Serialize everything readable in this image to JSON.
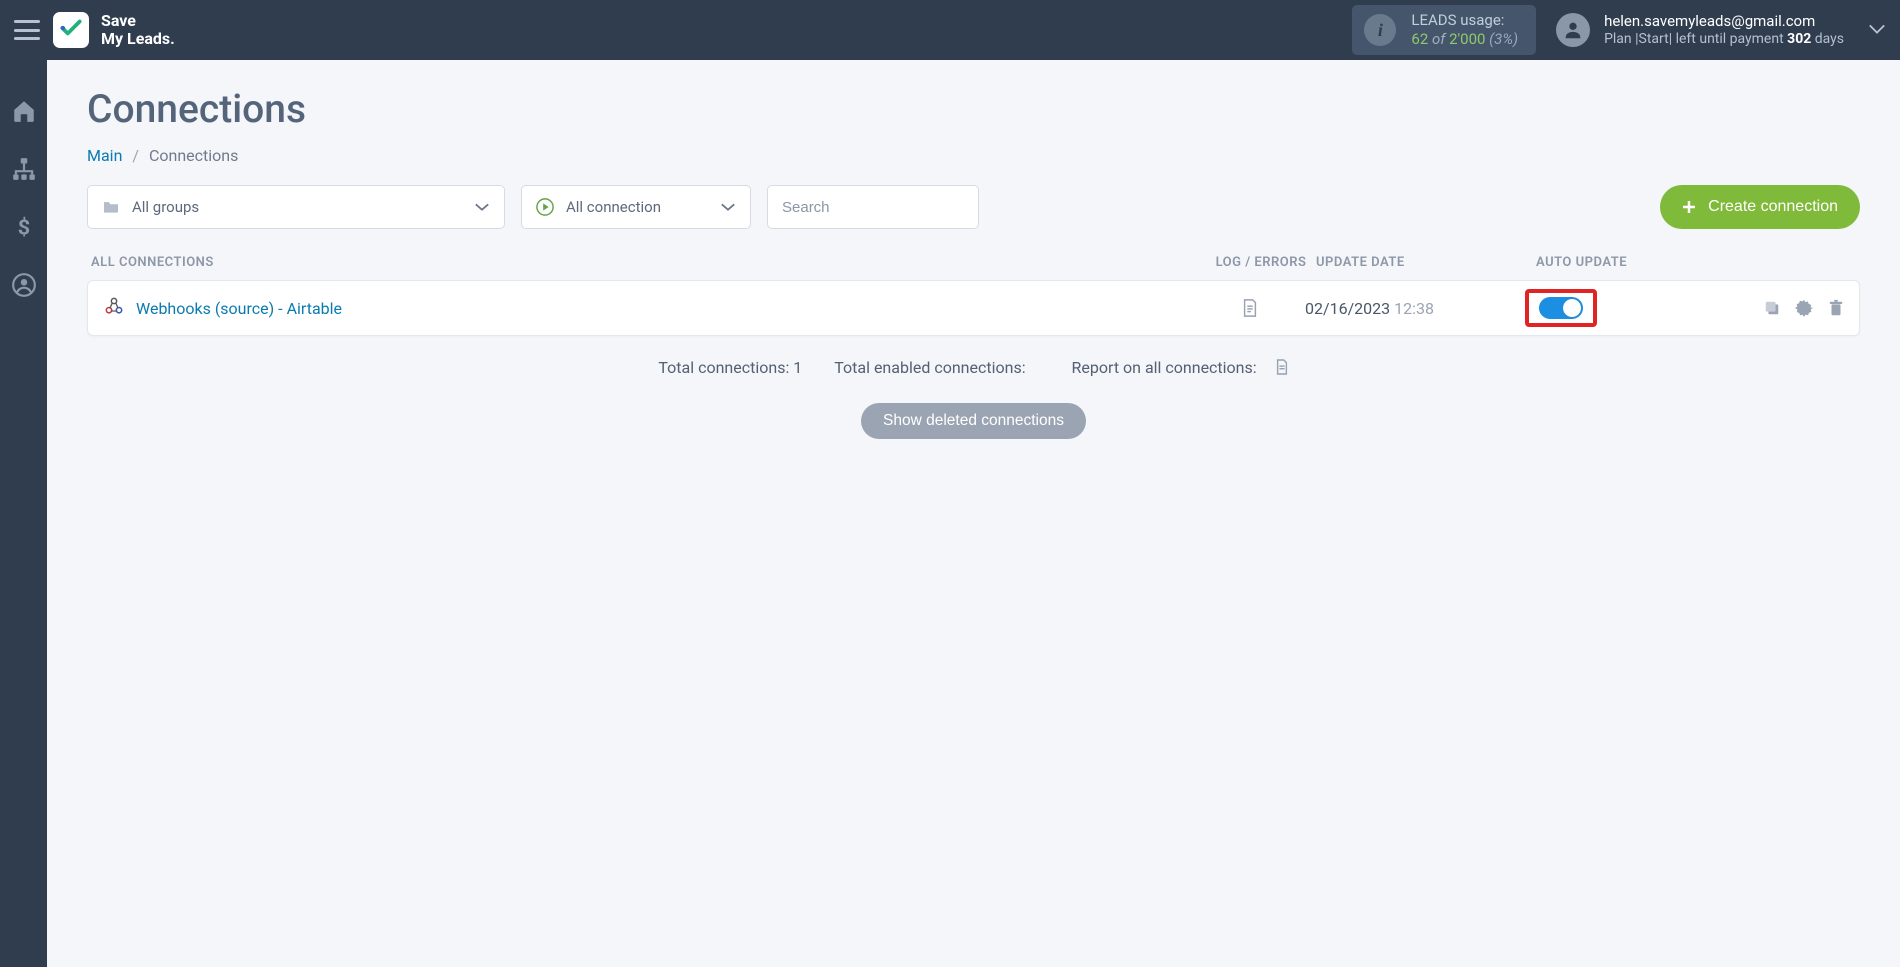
{
  "brand": {
    "line1": "Save",
    "line2": "My Leads."
  },
  "usage": {
    "label": "LEADS usage:",
    "used": "62",
    "of_word": "of",
    "limit": "2'000",
    "pct": "(3%)"
  },
  "account": {
    "email": "helen.savemyleads@gmail.com",
    "plan_prefix": "Plan |Start|  left until payment ",
    "plan_days": "302",
    "plan_suffix": " days"
  },
  "page": {
    "title": "Connections",
    "crumb_main": "Main",
    "crumb_current": "Connections"
  },
  "filters": {
    "groups_label": "All groups",
    "conn_label": "All connection",
    "search_placeholder": "Search",
    "create_label": "Create connection"
  },
  "columns": {
    "c1": "ALL CONNECTIONS",
    "c2": "LOG / ERRORS",
    "c3": "UPDATE DATE",
    "c4": "AUTO UPDATE"
  },
  "rows": [
    {
      "name": "Webhooks (source) - Airtable",
      "date": "02/16/2023",
      "time": "12:38"
    }
  ],
  "totals": {
    "t1": "Total connections: 1",
    "t2": "Total enabled connections:",
    "t3": "Report on all connections:"
  },
  "deleted_btn": "Show deleted connections"
}
